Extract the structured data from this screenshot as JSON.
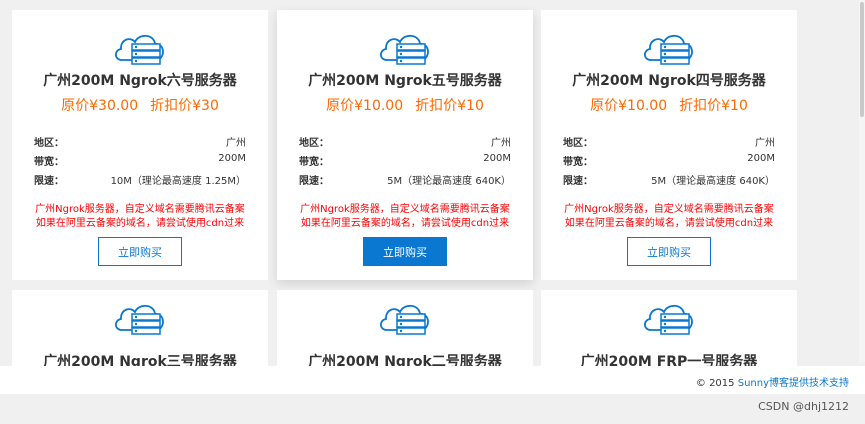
{
  "cards": [
    {
      "title": "广州200M Ngrok六号服务器",
      "original_price": "原价¥30.00",
      "discount_price": "折扣价¥30",
      "specs": [
        {
          "k": "地区：",
          "v": "广州"
        },
        {
          "k": "带宽：",
          "v": "200M"
        },
        {
          "k": "限速：",
          "v": "10M（理论最高速度 1.25M）"
        }
      ],
      "notice_line1": "广州Ngrok服务器，自定义域名需要腾讯云备案",
      "notice_line2": "如果在阿里云备案的域名，请尝试使用cdn过来",
      "buy_label": "立即购买"
    },
    {
      "title": "广州200M Ngrok五号服务器",
      "original_price": "原价¥10.00",
      "discount_price": "折扣价¥10",
      "specs": [
        {
          "k": "地区：",
          "v": "广州"
        },
        {
          "k": "带宽：",
          "v": "200M"
        },
        {
          "k": "限速：",
          "v": "5M（理论最高速度 640K）"
        }
      ],
      "notice_line1": "广州Ngrok服务器，自定义域名需要腾讯云备案",
      "notice_line2": "如果在阿里云备案的域名，请尝试使用cdn过来",
      "buy_label": "立即购买"
    },
    {
      "title": "广州200M Ngrok四号服务器",
      "original_price": "原价¥10.00",
      "discount_price": "折扣价¥10",
      "specs": [
        {
          "k": "地区：",
          "v": "广州"
        },
        {
          "k": "带宽：",
          "v": "200M"
        },
        {
          "k": "限速：",
          "v": "5M（理论最高速度 640K）"
        }
      ],
      "notice_line1": "广州Ngrok服务器，自定义域名需要腾讯云备案",
      "notice_line2": "如果在阿里云备案的域名，请尝试使用cdn过来",
      "buy_label": "立即购买"
    },
    {
      "title": "广州200M Ngrok三号服务器"
    },
    {
      "title": "广州200M Ngrok二号服务器"
    },
    {
      "title": "广州200M FRP一号服务器"
    }
  ],
  "footer": {
    "copyright": "© 2015",
    "link": "Sunny博客提供技术支持"
  },
  "watermark": "CSDN @dhj1212",
  "colors": {
    "accent": "#0a78d1",
    "price": "#ff6a00",
    "notice": "#ff0000"
  },
  "icons": {
    "card_icon": "cloud-server-icon"
  }
}
